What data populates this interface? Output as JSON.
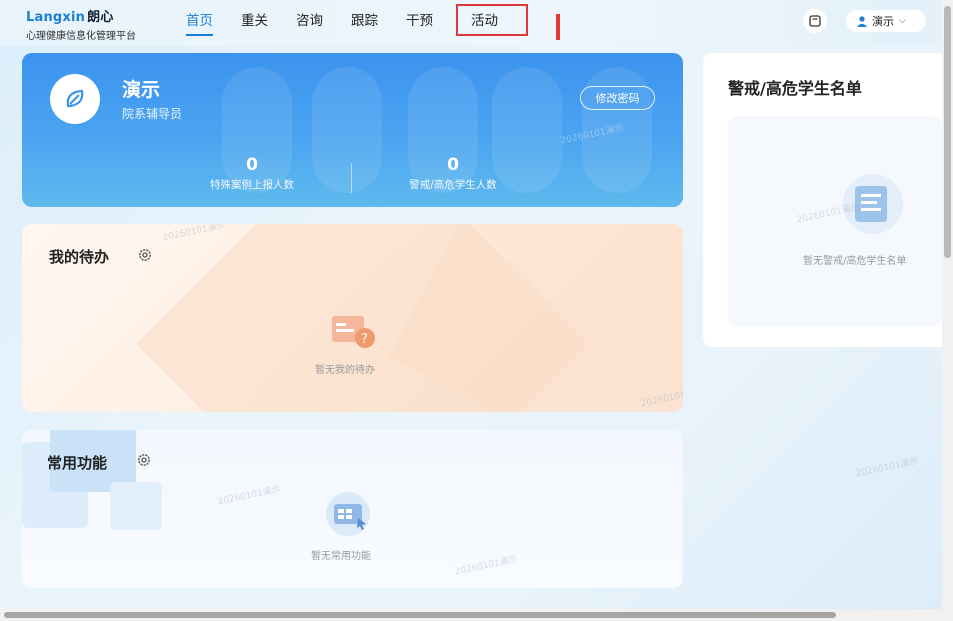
{
  "logo": {
    "brand": "Langxin",
    "brand_cn": "朗心",
    "subtitle": "心理健康信息化管理平台"
  },
  "nav": [
    {
      "label": "首页",
      "active": true
    },
    {
      "label": "重关",
      "active": false
    },
    {
      "label": "咨询",
      "active": false
    },
    {
      "label": "跟踪",
      "active": false
    },
    {
      "label": "干预",
      "active": false
    },
    {
      "label": "活动",
      "active": false
    }
  ],
  "user": {
    "name": "演示",
    "icon": "user-icon",
    "dropdown_icon": "chevron-down-icon"
  },
  "header_icons": {
    "message": "message-icon"
  },
  "banner": {
    "name": "演示",
    "role": "院系辅导员",
    "change_password": "修改密码",
    "stats": [
      {
        "value": "0",
        "label": "特殊案例上报人数"
      },
      {
        "value": "0",
        "label": "警戒/高危学生人数"
      }
    ]
  },
  "todo": {
    "title": "我的待办",
    "empty": "暂无我的待办",
    "settings_icon": "gear-icon"
  },
  "common": {
    "title": "常用功能",
    "empty": "暂无常用功能",
    "settings_icon": "gear-icon"
  },
  "alert_list": {
    "title": "警戒/高危学生名单",
    "empty": "暂无警戒/高危学生名单"
  },
  "watermark": "20260101演示",
  "colors": {
    "accent": "#1a7fd6",
    "highlight": "#e0393a",
    "banner": "#3c93ef"
  }
}
